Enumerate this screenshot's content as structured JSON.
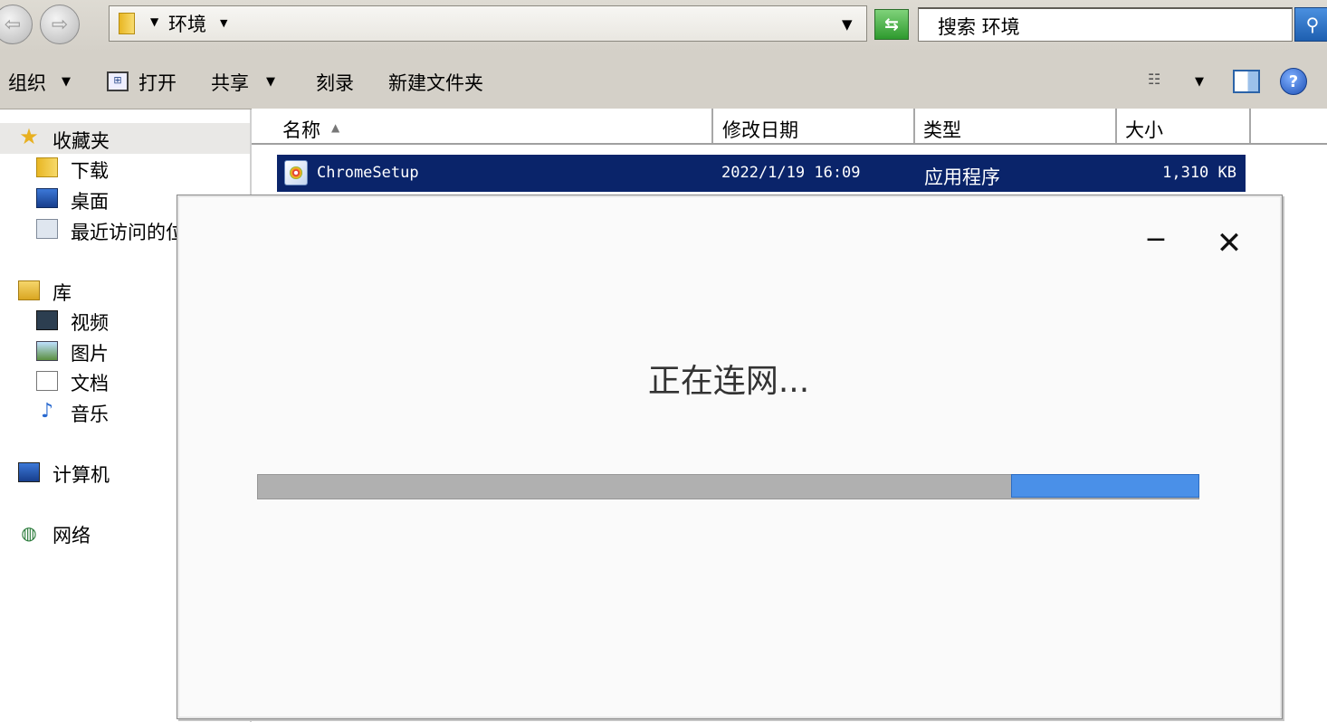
{
  "address_bar": {
    "crumb": "环境",
    "search_text": "搜索 环境"
  },
  "toolbar": {
    "organize": "组织",
    "open": "打开",
    "share": "共享",
    "burn": "刻录",
    "new_folder": "新建文件夹"
  },
  "nav": {
    "favorites": "收藏夹",
    "downloads": "下载",
    "desktop": "桌面",
    "recent": "最近访问的位置",
    "libraries": "库",
    "videos": "视频",
    "pictures": "图片",
    "documents": "文档",
    "music": "音乐",
    "computer": "计算机",
    "network": "网络"
  },
  "columns": {
    "name": "名称",
    "date": "修改日期",
    "type": "类型",
    "size": "大小"
  },
  "files": [
    {
      "name": "ChromeSetup",
      "date": "2022/1/19 16:09",
      "type": "应用程序",
      "size": "1,310 KB"
    }
  ],
  "dialog": {
    "status": "正在连网...",
    "minimize_glyph": "−",
    "close_glyph": "✕",
    "progress_segment": {
      "start_fraction": 0.8,
      "end_fraction": 1.0
    }
  },
  "colors": {
    "selection": "#0a246a",
    "progress_fill": "#4a90e8",
    "progress_track": "#b0b0b0"
  }
}
